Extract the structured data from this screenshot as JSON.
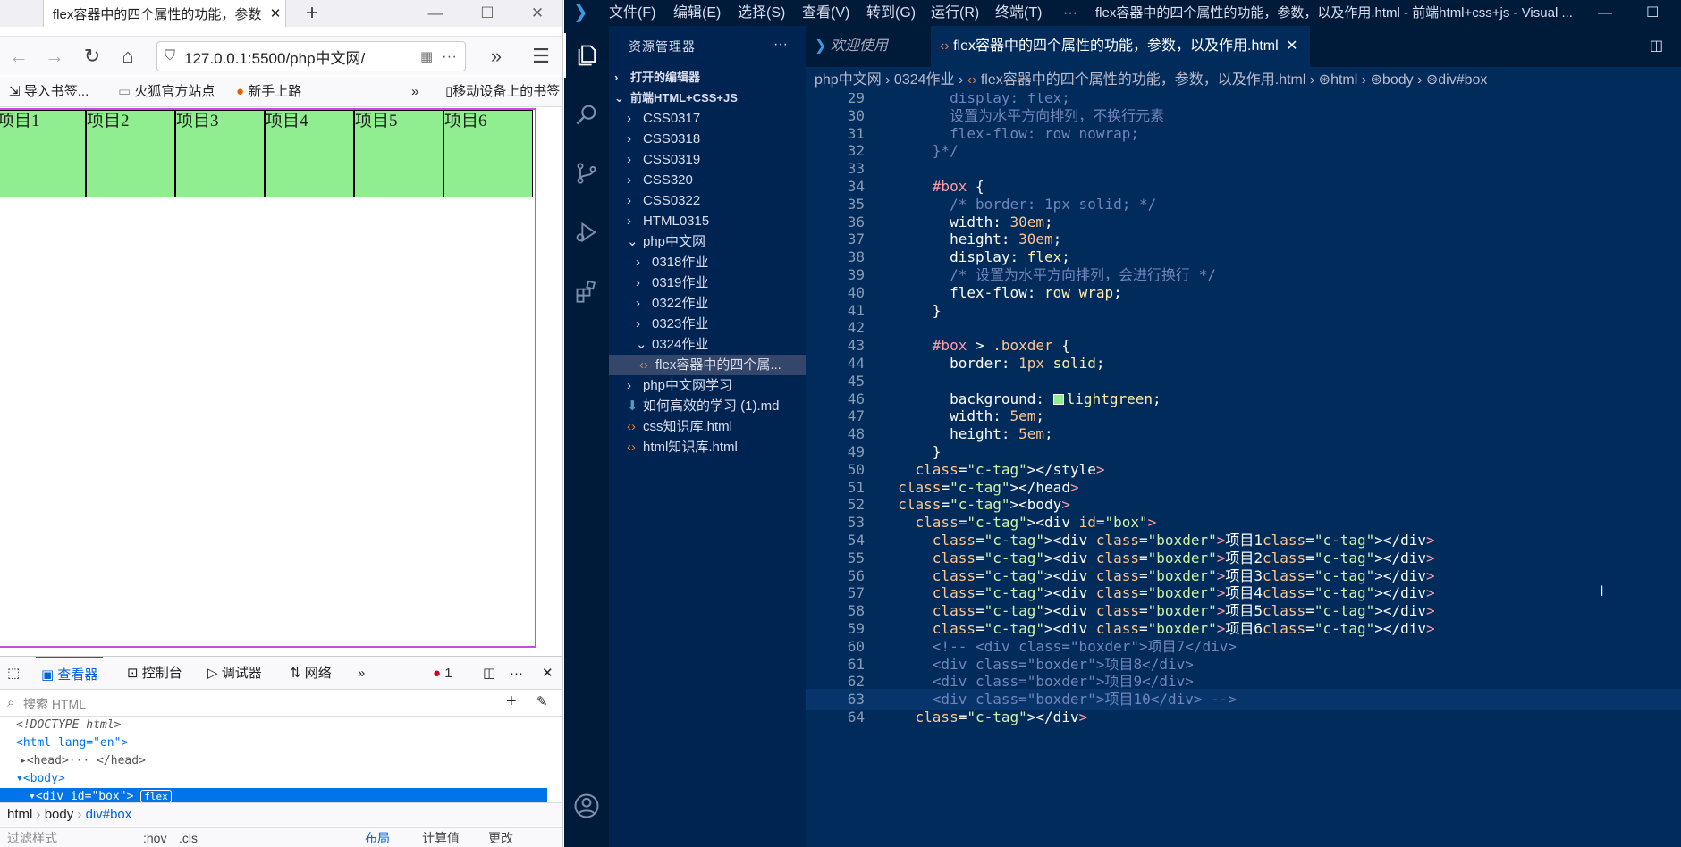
{
  "firefox": {
    "tab_title": "flex容器中的四个属性的功能，参数",
    "url": "127.0.0.1:5500/php中文网/",
    "bookmarks": {
      "import": "导入书签...",
      "official": "火狐官方站点",
      "newbie": "新手上路",
      "mobile": "移动设备上的书签"
    },
    "items": [
      "项目1",
      "项目2",
      "项目3",
      "项目4",
      "项目5",
      "项目6"
    ],
    "item_bg": "#90ee90",
    "devtools": {
      "tabs": {
        "inspector": "查看器",
        "console": "控制台",
        "debugger": "调试器",
        "network": "网络"
      },
      "error_count": "1",
      "search_placeholder": "搜索 HTML",
      "dom": {
        "doctype": "<!DOCTYPE html>",
        "html": "<html lang=\"en\">",
        "head": "<head>",
        "head_close": "</head>",
        "body": "<body>",
        "div": "<div id=\"box\">",
        "flex_badge": "flex"
      },
      "breadcrumb": [
        "html",
        "body",
        "div#box"
      ],
      "bottom": {
        "filter": "过滤样式",
        "hov": ":hov",
        "cls": ".cls",
        "layout": "布局",
        "computed": "计算值",
        "changes": "更改"
      }
    }
  },
  "vscode": {
    "menu": [
      "文件(F)",
      "编辑(E)",
      "选择(S)",
      "查看(V)",
      "转到(G)",
      "运行(R)",
      "终端(T)",
      "···"
    ],
    "window_title": "flex容器中的四个属性的功能，参数，以及作用.html - 前端html+css+js - Visual ...",
    "sidebar_title": "资源管理器",
    "tree": [
      {
        "label": "打开的编辑器",
        "type": "section-collapsed"
      },
      {
        "label": "前端HTML+CSS+JS",
        "type": "section-open"
      },
      {
        "label": "CSS0317",
        "type": "folder"
      },
      {
        "label": "CSS0318",
        "type": "folder"
      },
      {
        "label": "CSS0319",
        "type": "folder"
      },
      {
        "label": "CSS320",
        "type": "folder"
      },
      {
        "label": "CSS0322",
        "type": "folder"
      },
      {
        "label": "HTML0315",
        "type": "folder"
      },
      {
        "label": "php中文网",
        "type": "folder-open"
      },
      {
        "label": "0318作业",
        "type": "subfolder"
      },
      {
        "label": "0319作业",
        "type": "subfolder"
      },
      {
        "label": "0322作业",
        "type": "subfolder"
      },
      {
        "label": "0323作业",
        "type": "subfolder"
      },
      {
        "label": "0324作业",
        "type": "subfolder-open"
      },
      {
        "label": "flex容器中的四个属...",
        "type": "file-selected"
      },
      {
        "label": "php中文网学习",
        "type": "folder"
      },
      {
        "label": "如何高效的学习 (1).md",
        "type": "md"
      },
      {
        "label": "css知识库.html",
        "type": "html"
      },
      {
        "label": "html知识库.html",
        "type": "html"
      }
    ],
    "tabs": {
      "welcome": "欢迎使用",
      "active": "flex容器中的四个属性的功能，参数，以及作用.html"
    },
    "breadcrumb": [
      "php中文网",
      "0324作业",
      "flex容器中的四个属性的功能，参数，以及作用.html",
      "html",
      "body",
      "div#box"
    ],
    "code": [
      {
        "n": "29",
        "t": "        display: flex;"
      },
      {
        "n": "30",
        "t": "        设置为水平方向排列，不换行元素"
      },
      {
        "n": "31",
        "t": "        flex-flow: row nowrap;"
      },
      {
        "n": "32",
        "t": "      }*/"
      },
      {
        "n": "33",
        "t": ""
      },
      {
        "n": "34",
        "t": "      #box {"
      },
      {
        "n": "35",
        "t": "        /* border: 1px solid; */"
      },
      {
        "n": "36",
        "t": "        width: 30em;"
      },
      {
        "n": "37",
        "t": "        height: 30em;"
      },
      {
        "n": "38",
        "t": "        display: flex;"
      },
      {
        "n": "39",
        "t": "        /* 设置为水平方向排列，会进行换行 */"
      },
      {
        "n": "40",
        "t": "        flex-flow: row wrap;"
      },
      {
        "n": "41",
        "t": "      }"
      },
      {
        "n": "42",
        "t": ""
      },
      {
        "n": "43",
        "t": "      #box > .boxder {"
      },
      {
        "n": "44",
        "t": "        border: 1px solid;"
      },
      {
        "n": "45",
        "t": ""
      },
      {
        "n": "46",
        "t": "        background: lightgreen;"
      },
      {
        "n": "47",
        "t": "        width: 5em;"
      },
      {
        "n": "48",
        "t": "        height: 5em;"
      },
      {
        "n": "49",
        "t": "      }"
      },
      {
        "n": "50",
        "t": "    </style>"
      },
      {
        "n": "51",
        "t": "  </head>"
      },
      {
        "n": "52",
        "t": "  <body>"
      },
      {
        "n": "53",
        "t": "    <div id=\"box\">"
      },
      {
        "n": "54",
        "t": "      <div class=\"boxder\">项目1</div>"
      },
      {
        "n": "55",
        "t": "      <div class=\"boxder\">项目2</div>"
      },
      {
        "n": "56",
        "t": "      <div class=\"boxder\">项目3</div>"
      },
      {
        "n": "57",
        "t": "      <div class=\"boxder\">项目4</div>"
      },
      {
        "n": "58",
        "t": "      <div class=\"boxder\">项目5</div>"
      },
      {
        "n": "59",
        "t": "      <div class=\"boxder\">项目6</div>"
      },
      {
        "n": "60",
        "t": "      <!-- <div class=\"boxder\">项目7</div>"
      },
      {
        "n": "61",
        "t": "      <div class=\"boxder\">项目8</div>"
      },
      {
        "n": "62",
        "t": "      <div class=\"boxder\">项目9</div>"
      },
      {
        "n": "63",
        "t": "      <div class=\"boxder\">项目10</div> -->"
      },
      {
        "n": "64",
        "t": "    </div>"
      }
    ]
  }
}
